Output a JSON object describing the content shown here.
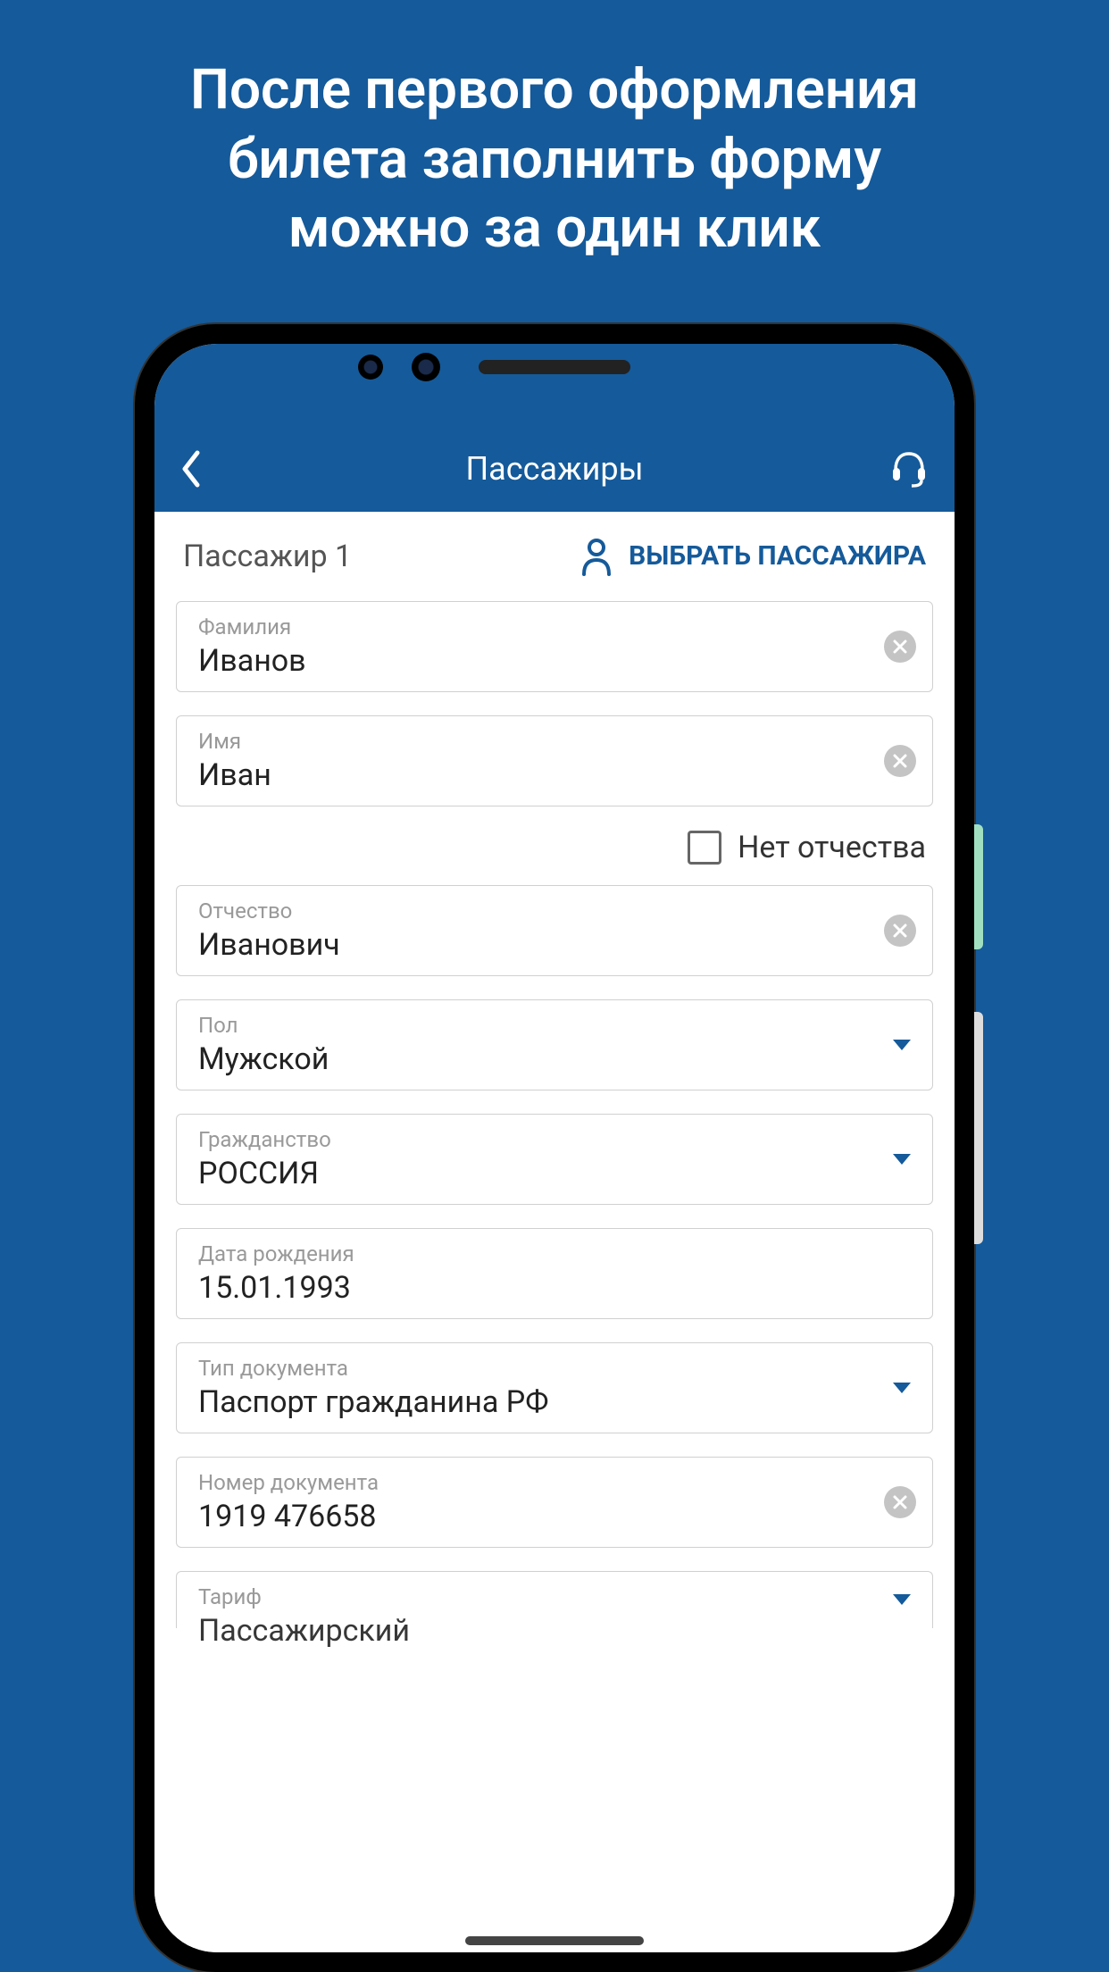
{
  "promo": {
    "line1": "После первого оформления",
    "line2": "билета заполнить форму",
    "line3": "можно за один клик"
  },
  "header": {
    "title": "Пассажиры"
  },
  "section": {
    "label": "Пассажир 1",
    "select_button": "ВЫБРАТЬ ПАССАЖИРА"
  },
  "fields": {
    "surname": {
      "label": "Фамилия",
      "value": "Иванов"
    },
    "name": {
      "label": "Имя",
      "value": "Иван"
    },
    "no_patronymic": "Нет отчества",
    "patronymic": {
      "label": "Отчество",
      "value": "Иванович"
    },
    "gender": {
      "label": "Пол",
      "value": "Мужской"
    },
    "citizenship": {
      "label": "Гражданство",
      "value": "РОССИЯ"
    },
    "birthdate": {
      "label": "Дата рождения",
      "value": "15.01.1993"
    },
    "doc_type": {
      "label": "Тип документа",
      "value": "Паспорт гражданина РФ"
    },
    "doc_number": {
      "label": "Номер документа",
      "value": "1919 476658"
    },
    "tariff": {
      "label": "Тариф",
      "value": "Пассажирский"
    }
  }
}
